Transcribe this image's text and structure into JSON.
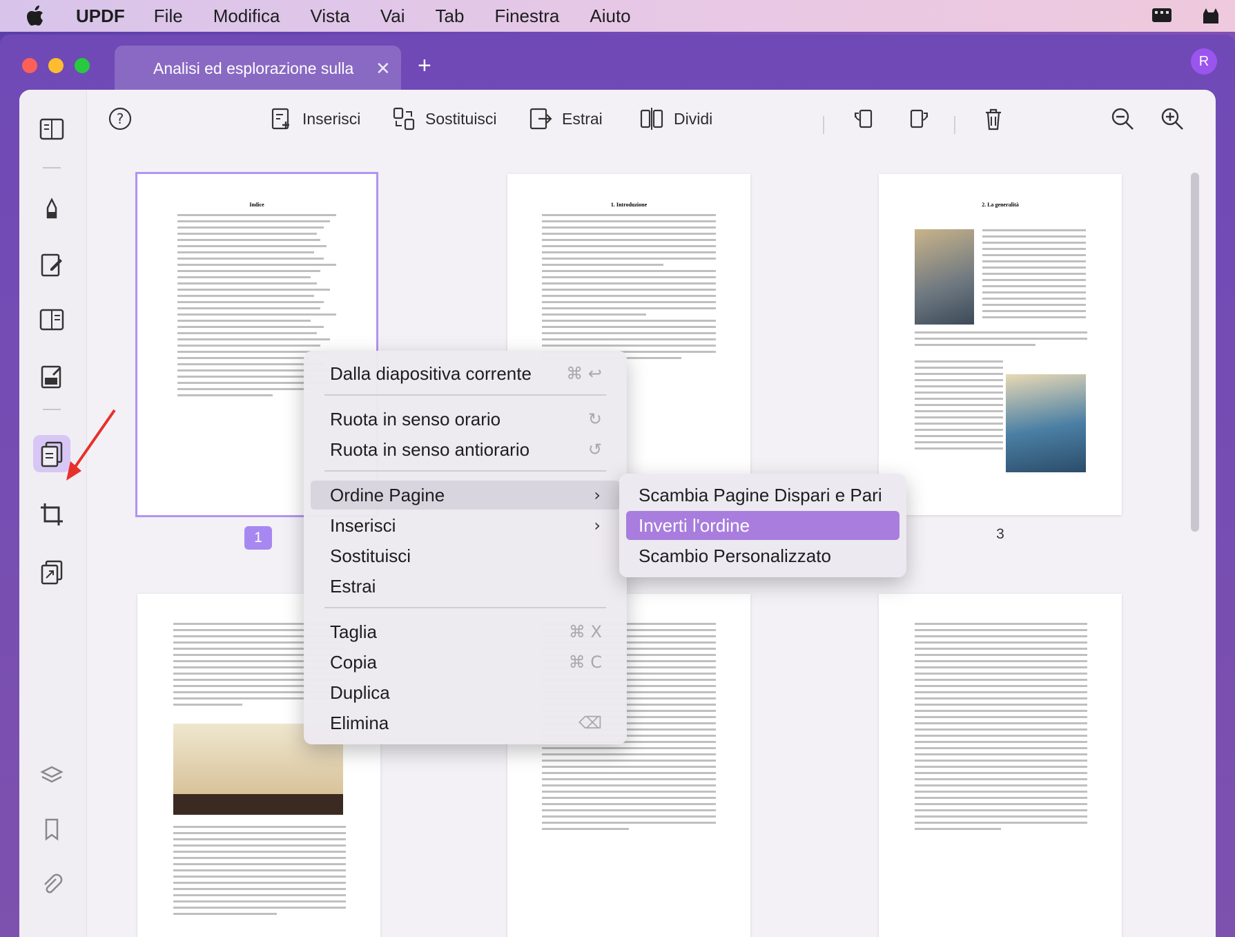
{
  "menubar": {
    "app_name": "UPDF",
    "items": [
      "File",
      "Modifica",
      "Vista",
      "Vai",
      "Tab",
      "Finestra",
      "Aiuto"
    ]
  },
  "tab": {
    "title": "Analisi ed esplorazione sulla"
  },
  "avatar": {
    "initial": "R"
  },
  "toolbar": {
    "insert": "Inserisci",
    "replace": "Sostituisci",
    "extract": "Estrai",
    "split": "Dividi"
  },
  "pages": {
    "p1_num": "1",
    "p3_num": "3",
    "p1_title": "Indice",
    "p2_title": "1. Introduzione",
    "p3_title": "2. La generalità"
  },
  "context_menu": {
    "from_current": "Dalla diapositiva corrente",
    "rotate_cw": "Ruota in senso orario",
    "rotate_ccw": "Ruota in senso antiorario",
    "page_order": "Ordine Pagine",
    "insert": "Inserisci",
    "replace": "Sostituisci",
    "extract": "Estrai",
    "cut": "Taglia",
    "copy": "Copia",
    "duplicate": "Duplica",
    "delete": "Elimina",
    "shortcut_cut": "⌘ X",
    "shortcut_copy": "⌘ C",
    "shortcut_from_current": "⌘ ↩"
  },
  "submenu": {
    "swap_odd_even": "Scambia Pagine Dispari e Pari",
    "reverse_order": "Inverti l'ordine",
    "custom_swap": "Scambio Personalizzato"
  },
  "colors": {
    "accent": "#a787f0",
    "highlight": "#a87dde",
    "annotation_arrow": "#e8302a"
  }
}
